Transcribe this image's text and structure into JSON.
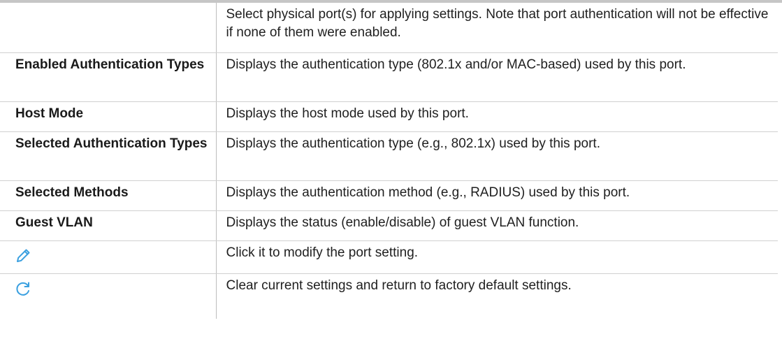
{
  "rows": [
    {
      "label": "",
      "description": "Select physical port(s) for applying settings. Note that port authentication will not be effective if none of them were enabled."
    },
    {
      "label": "Enabled Authentication Types",
      "description": "Displays the authentication type (802.1x and/or MAC-based) used by this port."
    },
    {
      "label": "Host Mode",
      "description": "Displays the host mode used by this port."
    },
    {
      "label": "Selected Authentication Types",
      "description": "Displays the authentication type (e.g., 802.1x) used by this port."
    },
    {
      "label": "Selected Methods",
      "description": "Displays the authentication method (e.g., RADIUS) used by this port."
    },
    {
      "label": "Guest VLAN",
      "description": "Displays the status (enable/disable) of guest VLAN function."
    },
    {
      "icon": "pencil-edit-icon",
      "description": "Click it to modify the port setting."
    },
    {
      "icon": "refresh-reset-icon",
      "description": "Clear current settings and return to factory default settings."
    }
  ],
  "colors": {
    "icon": "#3aa0e0",
    "border": "#d0d0d0",
    "divider": "#bdbdbd",
    "top_rule": "#c6c6c6"
  }
}
